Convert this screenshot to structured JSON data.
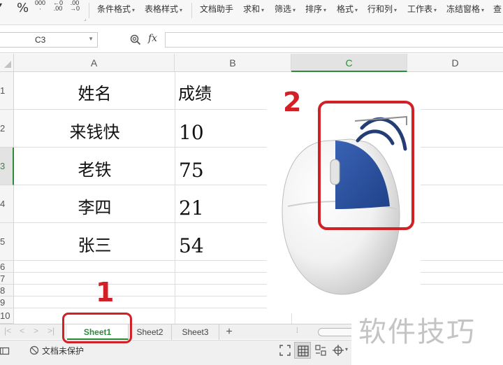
{
  "ribbon": {
    "percent_symbol": "%",
    "thousands_symbol": "000",
    "dec_increase": ".00",
    "dec_decrease": ".00",
    "items": [
      "条件格式",
      "表格样式",
      "文档助手",
      "求和",
      "筛选",
      "排序",
      "格式",
      "行和列",
      "工作表",
      "冻结窗格",
      "查"
    ]
  },
  "formula_bar": {
    "cell_ref": "C3",
    "fx_label": "fx",
    "formula_value": ""
  },
  "columns": [
    "A",
    "B",
    "C",
    "D"
  ],
  "rows": [
    "1",
    "2",
    "3",
    "4",
    "5",
    "6",
    "7",
    "8",
    "9",
    "10"
  ],
  "table": {
    "header": {
      "name": "姓名",
      "score": "成绩"
    },
    "data": [
      {
        "name": "来钱快",
        "score": "10"
      },
      {
        "name": "老铁",
        "score": "75"
      },
      {
        "name": "李四",
        "score": "21"
      },
      {
        "name": "张三",
        "score": "54"
      }
    ]
  },
  "sheets": {
    "tabs": [
      "Sheet1",
      "Sheet2",
      "Sheet3"
    ],
    "active": "Sheet1",
    "add_label": "+"
  },
  "status": {
    "protection_text": "文档未保护"
  },
  "annotations": {
    "step1": "1",
    "step2": "2",
    "color": "#d22027"
  },
  "watermark": {
    "text": "软件技巧"
  },
  "colors": {
    "selected_header": "#2e8b3a",
    "mouse_button": "#2a4f9c",
    "annotation_red": "#d22027"
  }
}
